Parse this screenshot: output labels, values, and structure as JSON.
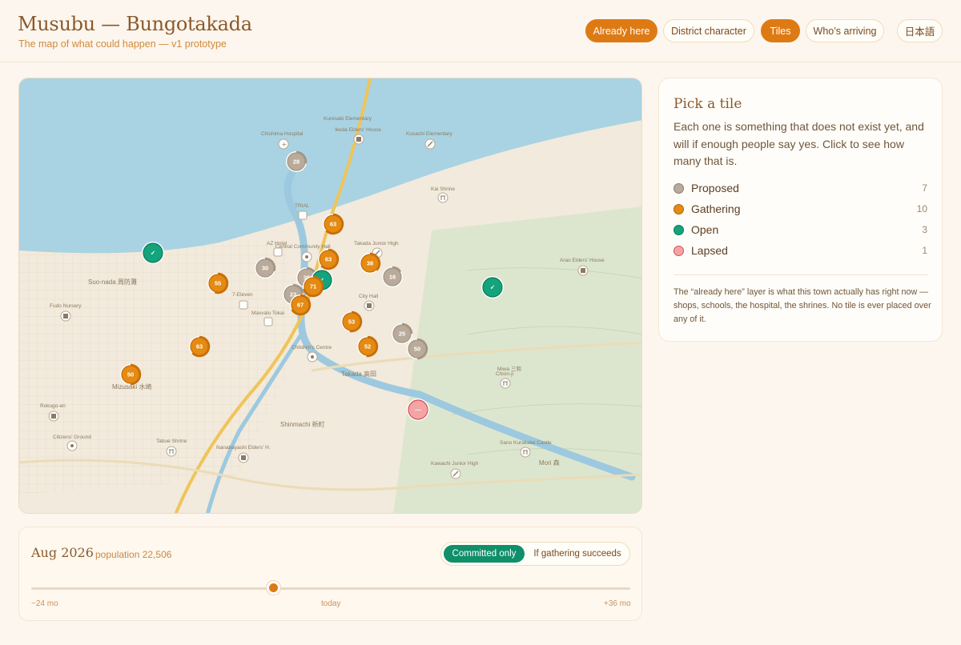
{
  "header": {
    "title": "Musubu — Bungotakada",
    "subtitle": "The map of what could happen — v1 prototype",
    "nav": [
      {
        "label": "Already here",
        "active": true
      },
      {
        "label": "District character",
        "active": false
      },
      {
        "label": "Tiles",
        "active": true
      },
      {
        "label": "Who’s arriving",
        "active": false
      },
      {
        "label": "日本語",
        "active": false
      }
    ]
  },
  "colors": {
    "accent": "#de7a14",
    "proposed": "#b9aa9a",
    "gathering": "#e58a12",
    "open": "#14a37a",
    "lapsed": "#f4a4a4",
    "water": "#a9d3e3",
    "road": "#efc45a"
  },
  "map": {
    "place_labels": [
      {
        "name": "Kuresaki Elementary"
      },
      {
        "name": "Ikeda Elders’ House"
      },
      {
        "name": "Chishima Hospital"
      },
      {
        "name": "Kusachi Elementary"
      },
      {
        "name": "Kai Shrine"
      },
      {
        "name": "TRIAL"
      },
      {
        "name": "AZ Hotel"
      },
      {
        "name": "Central Community Hall"
      },
      {
        "name": "Takada Junior High"
      },
      {
        "name": "Arao Elders’ House"
      },
      {
        "name": "Suo-nada 周防灘"
      },
      {
        "name": "7-Eleven"
      },
      {
        "name": "Maxvalu Tokai"
      },
      {
        "name": "City Hall"
      },
      {
        "name": "Fudo Nursery"
      },
      {
        "name": "Children’s Centre"
      },
      {
        "name": "Takada 高田"
      },
      {
        "name": "Miwa 三和"
      },
      {
        "name": "Chion-ji"
      },
      {
        "name": "Mizusaki 水崎"
      },
      {
        "name": "Rokugo-en"
      },
      {
        "name": "Shinmachi 新町"
      },
      {
        "name": "Citizens’ Ground"
      },
      {
        "name": "Tabue Shrine"
      },
      {
        "name": "Nanabayashi Elders’ H."
      },
      {
        "name": "Sano Kurakake Castle"
      },
      {
        "name": "Kawachi Junior High"
      },
      {
        "name": "Mori 森"
      }
    ],
    "tiles": [
      {
        "label": "28",
        "status": "proposed",
        "progress": 0.28
      },
      {
        "label": "63",
        "status": "gathering",
        "progress": 0.63
      },
      {
        "label": "✓",
        "status": "open",
        "progress": 1
      },
      {
        "label": "63",
        "status": "gathering",
        "progress": 0.63
      },
      {
        "label": "38",
        "status": "gathering",
        "progress": 0.38
      },
      {
        "label": "30",
        "status": "proposed",
        "progress": 0.3
      },
      {
        "label": "35",
        "status": "proposed",
        "progress": 0.35
      },
      {
        "label": "16",
        "status": "proposed",
        "progress": 0.16
      },
      {
        "label": "✓",
        "status": "open",
        "progress": 1
      },
      {
        "label": "55",
        "status": "gathering",
        "progress": 0.55
      },
      {
        "label": "23",
        "status": "proposed",
        "progress": 0.23
      },
      {
        "label": "71",
        "status": "gathering",
        "progress": 0.71
      },
      {
        "label": "67",
        "status": "gathering",
        "progress": 0.67
      },
      {
        "label": "✓",
        "status": "open",
        "progress": 1
      },
      {
        "label": "53",
        "status": "gathering",
        "progress": 0.53
      },
      {
        "label": "25",
        "status": "proposed",
        "progress": 0.25
      },
      {
        "label": "52",
        "status": "gathering",
        "progress": 0.52
      },
      {
        "label": "50",
        "status": "proposed",
        "progress": 0.5
      },
      {
        "label": "63",
        "status": "gathering",
        "progress": 0.63
      },
      {
        "label": "50",
        "status": "gathering",
        "progress": 0.5
      },
      {
        "label": "—",
        "status": "lapsed",
        "progress": 0
      }
    ]
  },
  "timeline": {
    "date": "Aug 2026",
    "population": "population 22,506",
    "mode_committed": "Committed only",
    "mode_if": "If gathering succeeds",
    "min_label": "−24 mo",
    "mid_label": "today",
    "max_label": "+36 mo",
    "slider_fraction": 0.405
  },
  "panel": {
    "title": "Pick a tile",
    "description": "Each one is something that does not exist yet, and will if enough people say yes. Click to see how many that is.",
    "legend": [
      {
        "key": "proposed",
        "label": "Proposed",
        "count": "7"
      },
      {
        "key": "gathering",
        "label": "Gathering",
        "count": "10"
      },
      {
        "key": "open",
        "label": "Open",
        "count": "3"
      },
      {
        "key": "lapsed",
        "label": "Lapsed",
        "count": "1"
      }
    ],
    "note": "The “already here” layer is what this town actually has right now — shops, schools, the hospital, the shrines. No tile is ever placed over any of it."
  }
}
